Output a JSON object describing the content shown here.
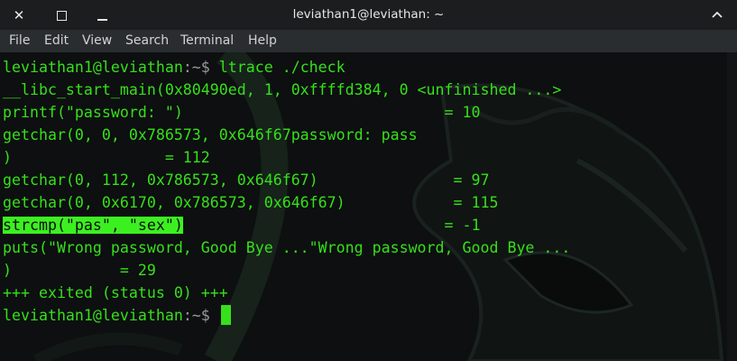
{
  "window": {
    "title": "leviathan1@leviathan: ~",
    "close_icon": "close-icon",
    "maximize_icon": "maximize-icon",
    "minimize_icon": "minimize-icon",
    "expand_icon": "expand-icon"
  },
  "menu": {
    "items": [
      "File",
      "Edit",
      "View",
      "Search",
      "Terminal",
      "Help"
    ]
  },
  "terminal": {
    "prompt_user": "leviathan1@leviathan",
    "prompt_path": ":~",
    "prompt_symbol": "$ ",
    "command": "ltrace ./check",
    "output": [
      "__libc_start_main(0x80490ed, 1, 0xffffd384, 0 <unfinished ...>",
      "printf(\"password: \")                             = 10",
      "getchar(0, 0, 0x786573, 0x646f67password: pass",
      ")                 = 112",
      "getchar(0, 112, 0x786573, 0x646f67)               = 97",
      "getchar(0, 0x6170, 0x786573, 0x646f67)            = 115",
      "strcmp(\"pas\", \"sex\")",
      "                             = -1",
      "puts(\"Wrong password, Good Bye ...\"Wrong password, Good Bye ...",
      ")            = 29",
      "+++ exited (status 0) +++"
    ],
    "final_prompt_user": "leviathan1@leviathan",
    "final_prompt_path": ":~",
    "final_prompt_symbol": "$ "
  },
  "colors": {
    "text_green": "#36e01a",
    "highlight": "#3cf020",
    "path_gray": "#9a9a9a",
    "background": "#0d0f10",
    "titlebar": "#1b1d1f",
    "menubar": "#2a2d30"
  }
}
